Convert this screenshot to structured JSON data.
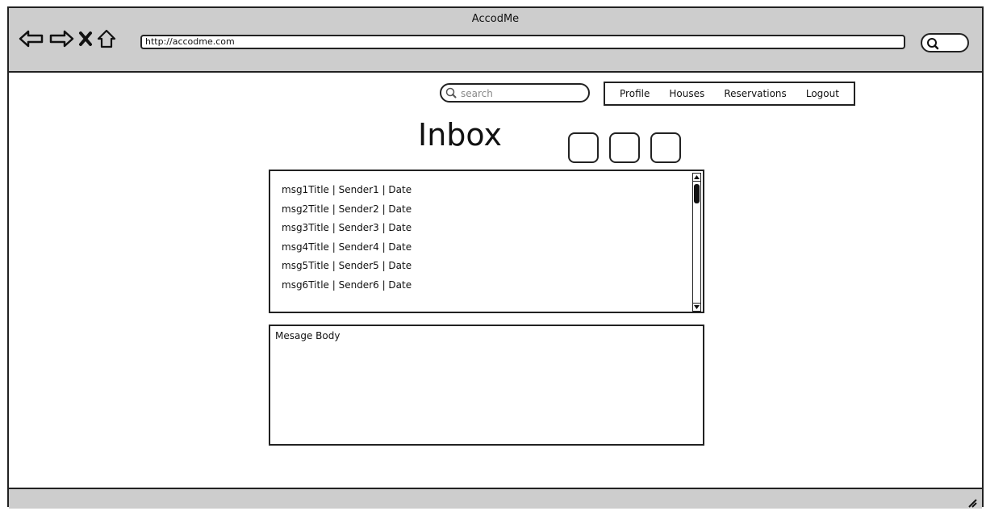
{
  "browser": {
    "window_title": "AccodMe",
    "url": "http://accodme.com",
    "icons": [
      "back-arrow-icon",
      "forward-arrow-icon",
      "close-icon",
      "home-icon",
      "search-icon"
    ]
  },
  "header": {
    "search": {
      "placeholder": "search"
    },
    "menu": [
      "Profile",
      "Houses",
      "Reservations",
      "Logout"
    ]
  },
  "main": {
    "title": "Inbox",
    "messages": [
      "msg1Title | Sender1 | Date",
      "msg2Title | Sender2 | Date",
      "msg3Title | Sender3 | Date",
      "msg4Title | Sender4 | Date",
      "msg5Title | Sender5 | Date",
      "msg6Title | Sender6 | Date"
    ],
    "message_body_label": "Mesage Body"
  }
}
